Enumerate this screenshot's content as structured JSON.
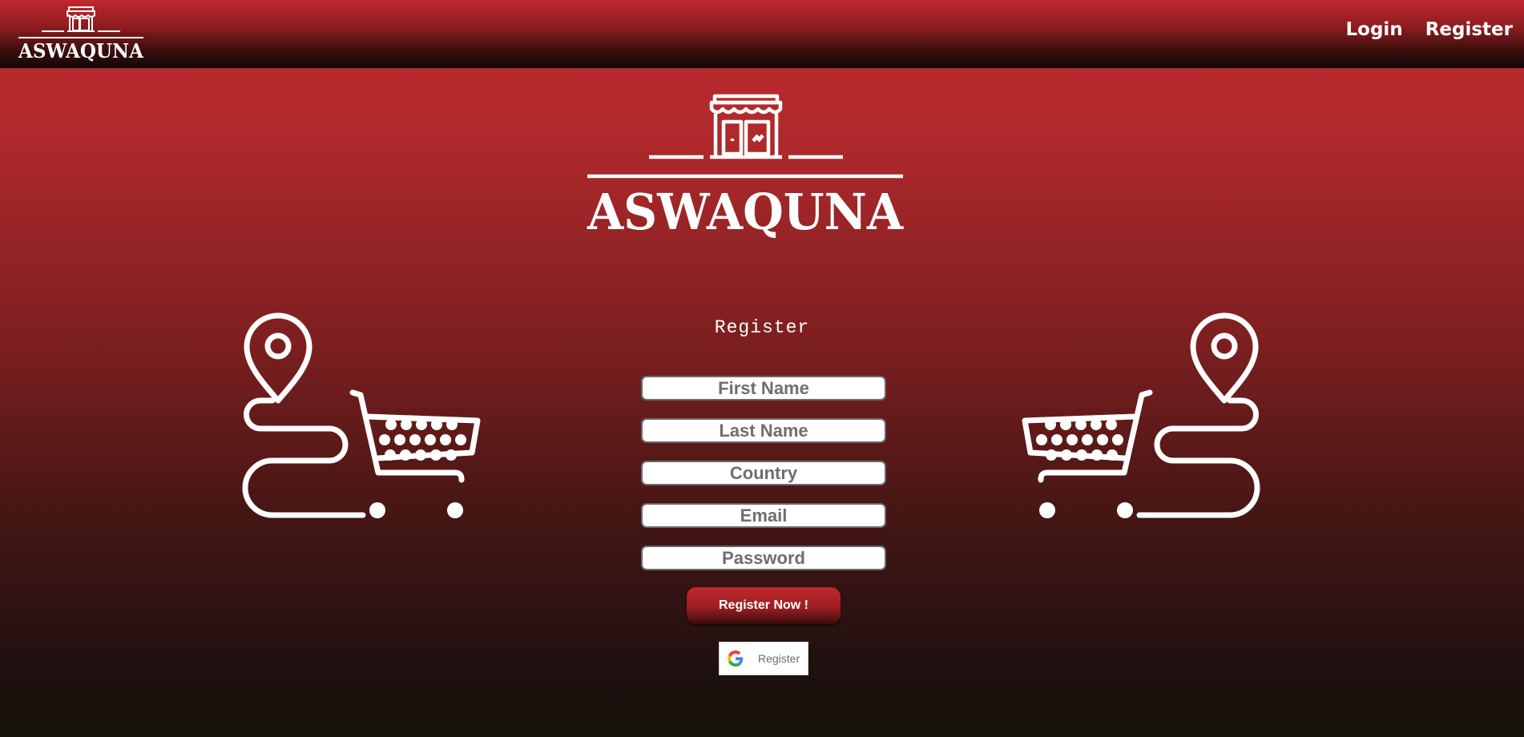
{
  "header": {
    "logo_text": "ASWAQUNA",
    "nav": [
      {
        "label": "Login"
      },
      {
        "label": "Register"
      }
    ]
  },
  "hero": {
    "logo_text": "ASWAQUNA"
  },
  "form": {
    "title": "Register",
    "fields": {
      "first_name": {
        "placeholder": "First Name",
        "value": ""
      },
      "last_name": {
        "placeholder": "Last Name",
        "value": ""
      },
      "country": {
        "placeholder": "Country",
        "value": ""
      },
      "email": {
        "placeholder": "Email",
        "value": ""
      },
      "password": {
        "placeholder": "Password",
        "value": ""
      }
    },
    "submit_label": "Register Now !",
    "google_label": "Register"
  },
  "colors": {
    "brand_red": "#bd2a2e",
    "dark": "#14120b",
    "text_light": "#ffffff"
  },
  "icons": [
    "storefront-icon",
    "location-pin-icon",
    "shopping-cart-icon",
    "google-icon"
  ]
}
